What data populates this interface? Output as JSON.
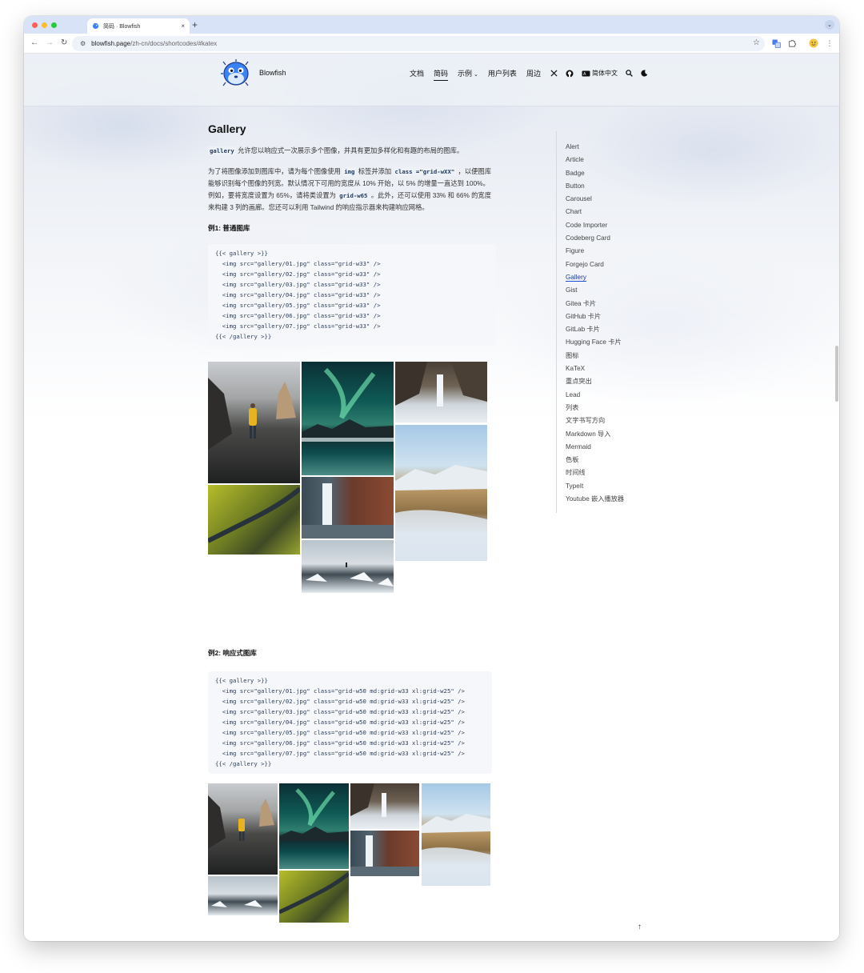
{
  "browser": {
    "tab_title": "简码 · Blowfish",
    "new_tab": "+",
    "close_tab": "×",
    "url_domain": "blowfish.page",
    "url_path": "/zh-cn/docs/shortcodes/#katex"
  },
  "header": {
    "brand": "Blowfish",
    "nav": [
      "文档",
      "简码",
      "示例",
      "用户列表",
      "周边"
    ],
    "active_nav": "简码",
    "lang": "简体中文"
  },
  "content": {
    "title": "Gallery",
    "intro_code": "gallery",
    "intro_text": " 允许您以响应式一次展示多个图像，并具有更加多样化和有趣的布局的图库。",
    "para_1": "为了将图像添加到图库中，请为每个图像使用 ",
    "para_code_1": "img",
    "para_2": " 标签并添加 ",
    "para_code_2": "class =\"grid-wXX\"",
    "para_3": " ，以便图库能够识别每个图像的列宽。默认情况下可用的宽度从 10% 开始，以 5% 的增量一直达到 100%。例如，要将宽度设置为 65%，请将类设置为 ",
    "para_code_3": "grid-w65",
    "para_4": " 。此外，还可以使用 33% 和 66% 的宽度来构建 3 列的画廊。您还可以利用 Tailwind 的响应指示器来构建响应网格。",
    "example1_title": "例1: 普通图库",
    "example1_code": "{{< gallery >}}\n  <img src=\"gallery/01.jpg\" class=\"grid-w33\" />\n  <img src=\"gallery/02.jpg\" class=\"grid-w33\" />\n  <img src=\"gallery/03.jpg\" class=\"grid-w33\" />\n  <img src=\"gallery/04.jpg\" class=\"grid-w33\" />\n  <img src=\"gallery/05.jpg\" class=\"grid-w33\" />\n  <img src=\"gallery/06.jpg\" class=\"grid-w33\" />\n  <img src=\"gallery/07.jpg\" class=\"grid-w33\" />\n{{< /gallery >}}",
    "example2_title": "例2: 响应式图库",
    "example2_code": "{{< gallery >}}\n  <img src=\"gallery/01.jpg\" class=\"grid-w50 md:grid-w33 xl:grid-w25\" />\n  <img src=\"gallery/02.jpg\" class=\"grid-w50 md:grid-w33 xl:grid-w25\" />\n  <img src=\"gallery/03.jpg\" class=\"grid-w50 md:grid-w33 xl:grid-w25\" />\n  <img src=\"gallery/04.jpg\" class=\"grid-w50 md:grid-w33 xl:grid-w25\" />\n  <img src=\"gallery/05.jpg\" class=\"grid-w50 md:grid-w33 xl:grid-w25\" />\n  <img src=\"gallery/06.jpg\" class=\"grid-w50 md:grid-w33 xl:grid-w25\" />\n  <img src=\"gallery/07.jpg\" class=\"grid-w50 md:grid-w33 xl:grid-w25\" />\n{{< /gallery >}}"
  },
  "toc": {
    "items": [
      "Alert",
      "Article",
      "Badge",
      "Button",
      "Carousel",
      "Chart",
      "Code Importer",
      "Codeberg Card",
      "Figure",
      "Forgejo Card",
      "Gallery",
      "Gist",
      "Gitea 卡片",
      "GitHub 卡片",
      "GitLab 卡片",
      "Hugging Face 卡片",
      "图标",
      "KaTeX",
      "重点突出",
      "Lead",
      "列表",
      "文字书写方向",
      "Markdown 导入",
      "Mermaid",
      "色板",
      "时间线",
      "TypeIt",
      "Youtube 嵌入播放器"
    ],
    "active": "Gallery"
  },
  "back_to_top": "↑",
  "colors": {
    "accent": "#1d4ed8",
    "text": "#1f2937",
    "code_bg": "#f5f7fa"
  }
}
